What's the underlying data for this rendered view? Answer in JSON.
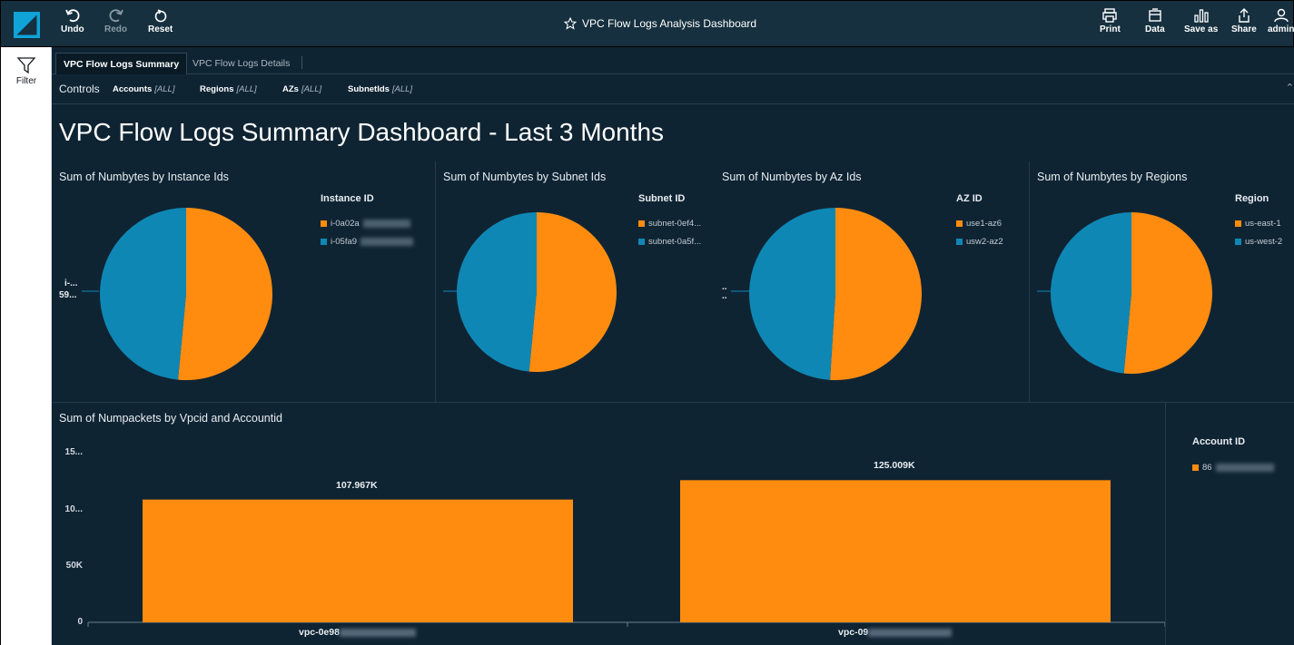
{
  "toolbar": {
    "undo": "Undo",
    "redo": "Redo",
    "reset": "Reset",
    "title": "VPC Flow Logs Analysis Dashboard",
    "print": "Print",
    "data": "Data",
    "save_as": "Save as",
    "share": "Share",
    "user": "admin"
  },
  "sidebar": {
    "filter": "Filter"
  },
  "tabs": [
    {
      "label": "VPC Flow Logs Summary",
      "active": true
    },
    {
      "label": "VPC Flow Logs Details",
      "active": false
    }
  ],
  "controls": {
    "label": "Controls",
    "items": [
      {
        "name": "Accounts",
        "value": "[ALL]"
      },
      {
        "name": "Regions",
        "value": "[ALL]"
      },
      {
        "name": "AZs",
        "value": "[ALL]"
      },
      {
        "name": "SubnetIds",
        "value": "[ALL]"
      }
    ]
  },
  "dashboard_title": "VPC Flow Logs Summary Dashboard - Last 3 Months",
  "colors": {
    "orange": "#ff8c0f",
    "blue": "#0f87b5",
    "background": "#0f2433",
    "toolbar": "#16303f"
  },
  "chart_data": [
    {
      "type": "pie",
      "title": "Sum of Numbytes by Instance Ids",
      "legend_title": "Instance ID",
      "slice_labels": [
        "i-...",
        "59..."
      ],
      "series": [
        {
          "name": "i-0a02a",
          "value": 51.5,
          "color": "#ff8c0f"
        },
        {
          "name": "i-05fa9",
          "value": 48.5,
          "color": "#0f87b5"
        }
      ]
    },
    {
      "type": "pie",
      "title": "Sum of Numbytes by Subnet Ids",
      "legend_title": "Subnet ID",
      "slice_labels": [],
      "series": [
        {
          "name": "subnet-0ef4...",
          "value": 51.5,
          "color": "#ff8c0f"
        },
        {
          "name": "subnet-0a5f...",
          "value": 48.5,
          "color": "#0f87b5"
        }
      ]
    },
    {
      "type": "pie",
      "title": "Sum of Numbytes by Az Ids",
      "legend_title": "AZ ID",
      "slice_labels": [
        "..",
        ".."
      ],
      "series": [
        {
          "name": "use1-az6",
          "value": 51,
          "color": "#ff8c0f"
        },
        {
          "name": "usw2-az2",
          "value": 49,
          "color": "#0f87b5"
        }
      ]
    },
    {
      "type": "pie",
      "title": "Sum of Numbytes by Regions",
      "legend_title": "Region",
      "slice_labels": [],
      "series": [
        {
          "name": "us-east-1",
          "value": 51.5,
          "color": "#ff8c0f"
        },
        {
          "name": "us-west-2",
          "value": 48.5,
          "color": "#0f87b5"
        }
      ]
    },
    {
      "type": "bar",
      "title": "Sum of Numpackets by Vpcid and Accountid",
      "legend_title": "Account ID",
      "legend_items": [
        "86"
      ],
      "categories": [
        "vpc-0e98",
        "vpc-09"
      ],
      "values": [
        107967,
        125009
      ],
      "data_labels": [
        "107.967K",
        "125.009K"
      ],
      "yticks": [
        {
          "label": "0",
          "value": 0
        },
        {
          "label": "50K",
          "value": 50000
        },
        {
          "label": "10...",
          "value": 100000
        },
        {
          "label": "15...",
          "value": 150000
        }
      ],
      "ylim": [
        0,
        150000
      ],
      "color": "#ff8c0f"
    }
  ]
}
